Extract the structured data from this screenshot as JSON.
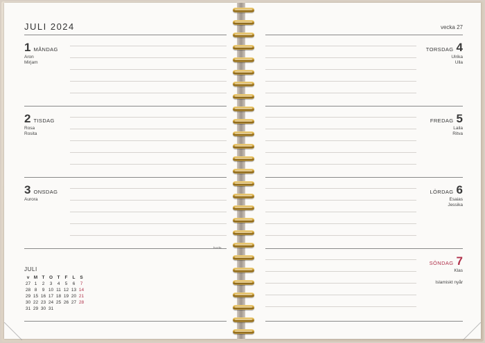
{
  "header": {
    "month_year": "JULI 2024",
    "week": "vecka 27"
  },
  "days": [
    {
      "num": "1",
      "name": "MÅNDAG",
      "names": [
        "Aron",
        "Mirjam"
      ]
    },
    {
      "num": "2",
      "name": "TISDAG",
      "names": [
        "Rosa",
        "Rosita"
      ]
    },
    {
      "num": "3",
      "name": "ONSDAG",
      "names": [
        "Aurora"
      ]
    },
    {
      "num": "4",
      "name": "TORSDAG",
      "names": [
        "Ulrika",
        "Ulla"
      ]
    },
    {
      "num": "5",
      "name": "FREDAG",
      "names": [
        "Laila",
        "Ritva"
      ]
    },
    {
      "num": "6",
      "name": "LÖRDAG",
      "names": [
        "Esaias",
        "Jessika"
      ]
    },
    {
      "num": "7",
      "name": "SÖNDAG",
      "names": [
        "Klas"
      ],
      "holiday": "Islamiskt nyår"
    }
  ],
  "note_small": "burde",
  "mini_calendar": {
    "title": "JULI",
    "headers": [
      "v",
      "M",
      "T",
      "O",
      "T",
      "F",
      "L",
      "S"
    ],
    "rows": [
      [
        "27",
        "1",
        "2",
        "3",
        "4",
        "5",
        "6",
        "7"
      ],
      [
        "28",
        "8",
        "9",
        "10",
        "11",
        "12",
        "13",
        "14"
      ],
      [
        "29",
        "15",
        "16",
        "17",
        "18",
        "19",
        "20",
        "21"
      ],
      [
        "30",
        "22",
        "23",
        "24",
        "25",
        "26",
        "27",
        "28"
      ],
      [
        "31",
        "29",
        "30",
        "31",
        "",
        "",
        "",
        ""
      ]
    ]
  },
  "colors": {
    "sunday": "#b0304a",
    "ring_gold": "#c99a2e",
    "paper": "#fbfaf8"
  }
}
